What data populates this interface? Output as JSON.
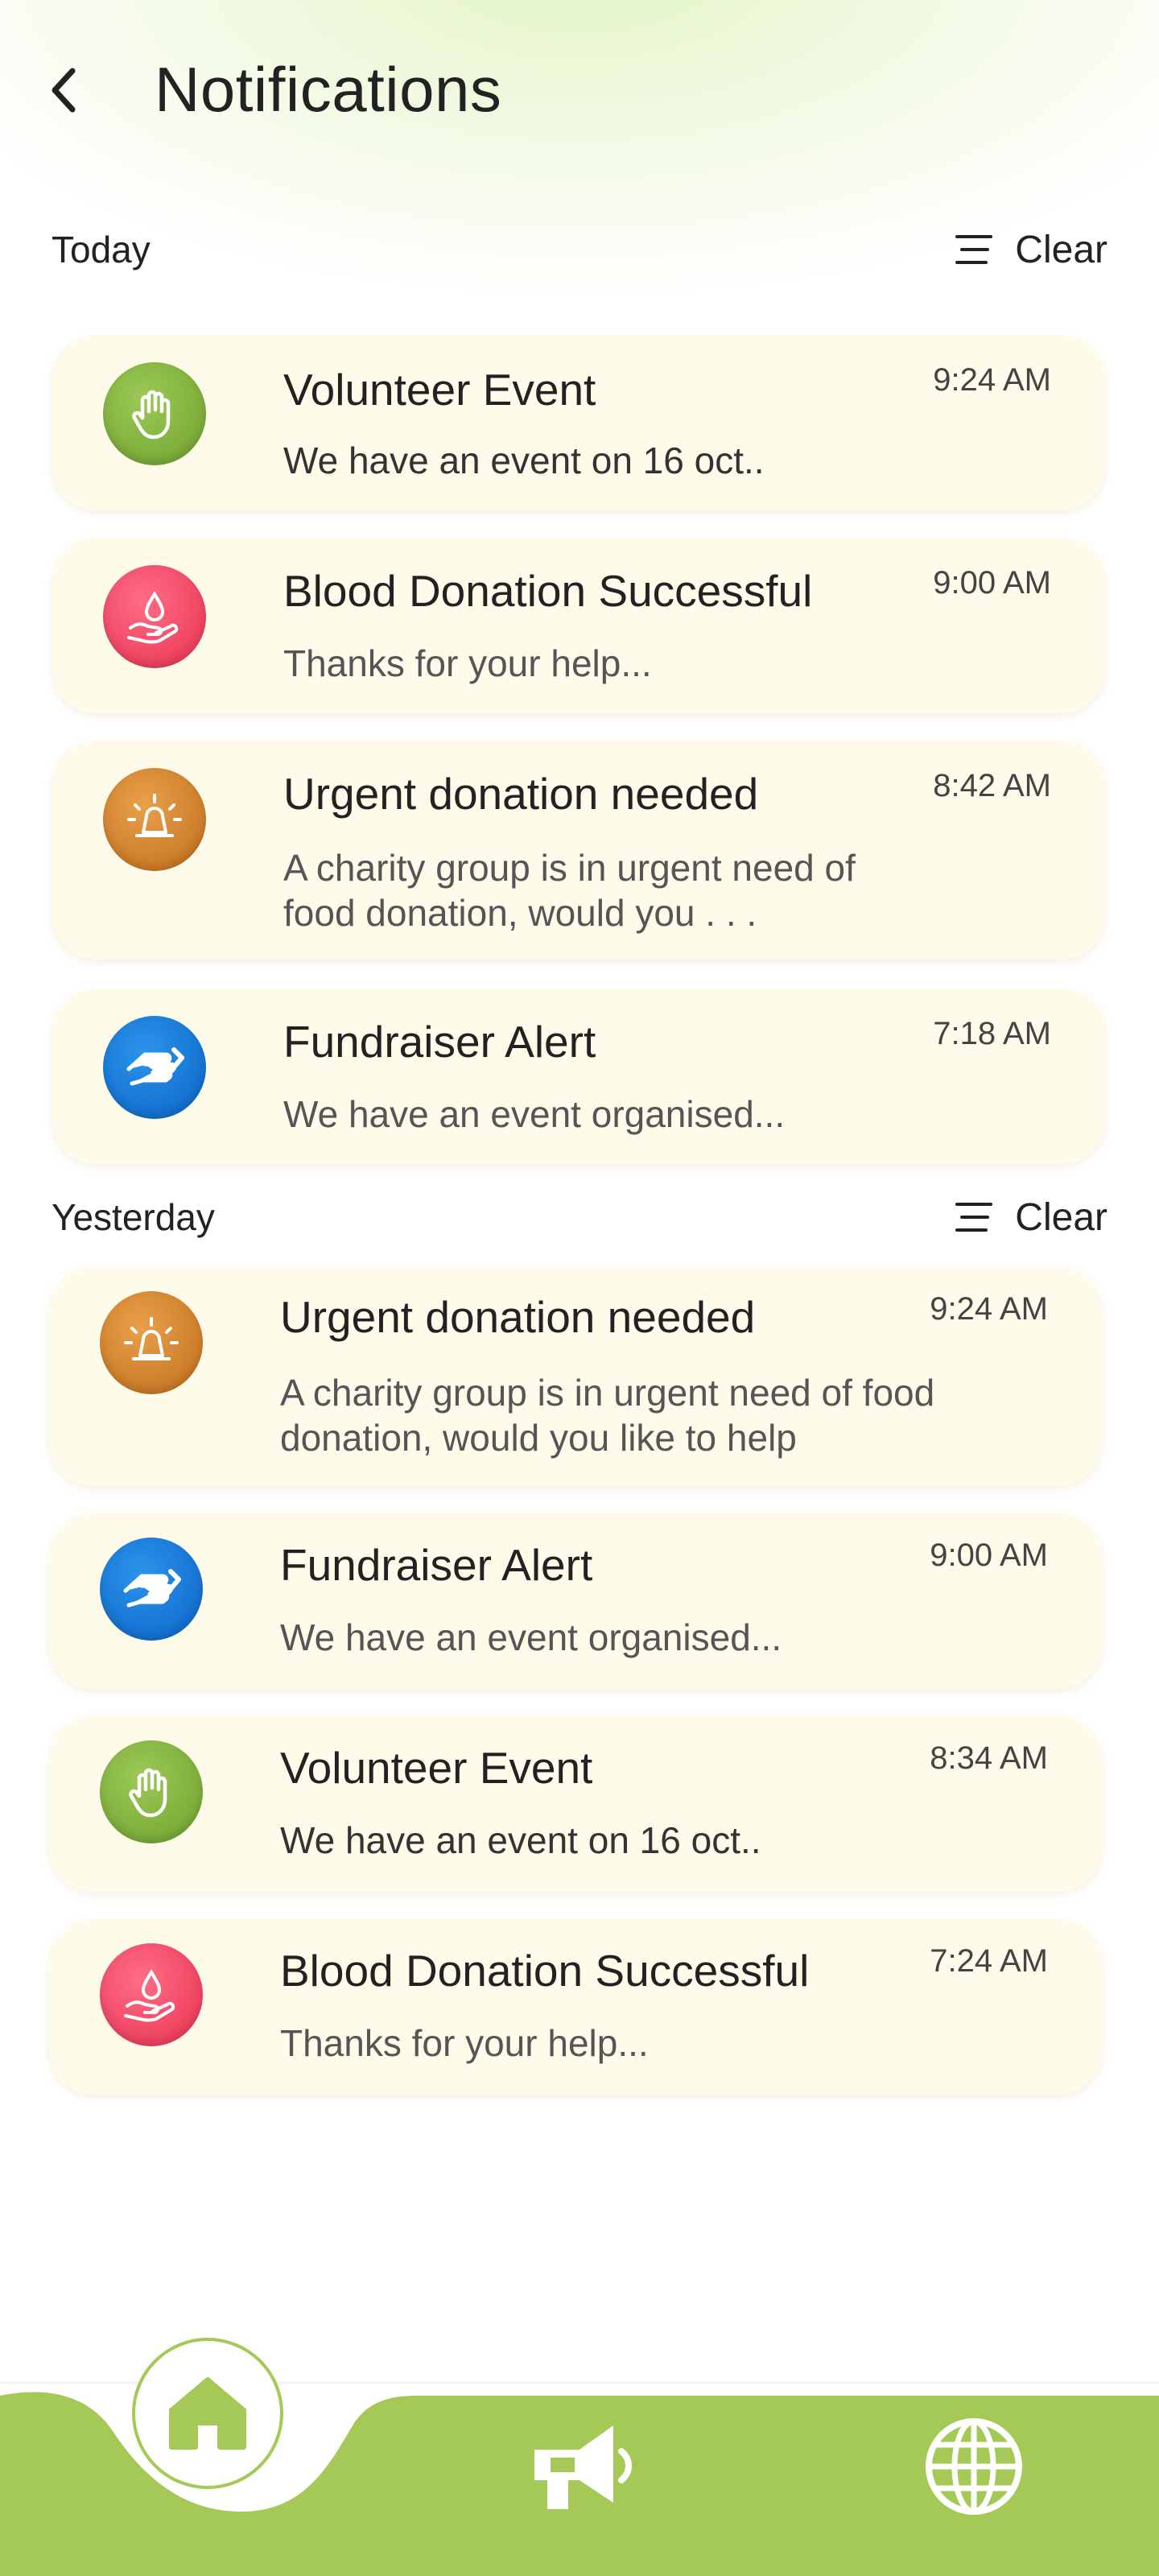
{
  "header": {
    "title": "Notifications"
  },
  "sections": [
    {
      "label": "Today",
      "clear_label": "Clear",
      "items": [
        {
          "title": "Volunteer Event",
          "time": "9:24 AM",
          "body": "We have an event on 16 oct..",
          "icon": "raised-hand-icon",
          "color": "#7fae3c"
        },
        {
          "title": "Blood Donation Successful",
          "time": "9:00 AM",
          "body": "Thanks for your help...",
          "icon": "blood-drop-hand-icon",
          "color": "#f0445f"
        },
        {
          "title": "Urgent donation needed",
          "time": "8:42 AM",
          "body": "A charity group is in urgent need of food donation, would you . . .",
          "icon": "siren-icon",
          "color": "#d3852f"
        },
        {
          "title": "Fundraiser Alert",
          "time": "7:18 AM",
          "body": "We have an event organised...",
          "icon": "handshake-icon",
          "color": "#1a7fdc"
        }
      ]
    },
    {
      "label": "Yesterday",
      "clear_label": "Clear",
      "items": [
        {
          "title": "Urgent donation needed",
          "time": "9:24 AM",
          "body": "A charity group is in urgent need of food donation, would you like to help",
          "icon": "siren-icon",
          "color": "#d3852f"
        },
        {
          "title": "Fundraiser Alert",
          "time": "9:00 AM",
          "body": "We have an event organised...",
          "icon": "handshake-icon",
          "color": "#1a7fdc"
        },
        {
          "title": "Volunteer Event",
          "time": "8:34 AM",
          "body": "We have an event on 16 oct..",
          "icon": "raised-hand-icon",
          "color": "#7fae3c"
        },
        {
          "title": "Blood Donation Successful",
          "time": "7:24 AM",
          "body": "Thanks for your help...",
          "icon": "blood-drop-hand-icon",
          "color": "#f0445f"
        }
      ]
    }
  ],
  "bottom_nav": {
    "items": [
      {
        "icon": "home-icon",
        "active": true
      },
      {
        "icon": "megaphone-icon",
        "active": false
      },
      {
        "icon": "globe-icon",
        "active": false
      }
    ],
    "color": "#a4c956"
  }
}
